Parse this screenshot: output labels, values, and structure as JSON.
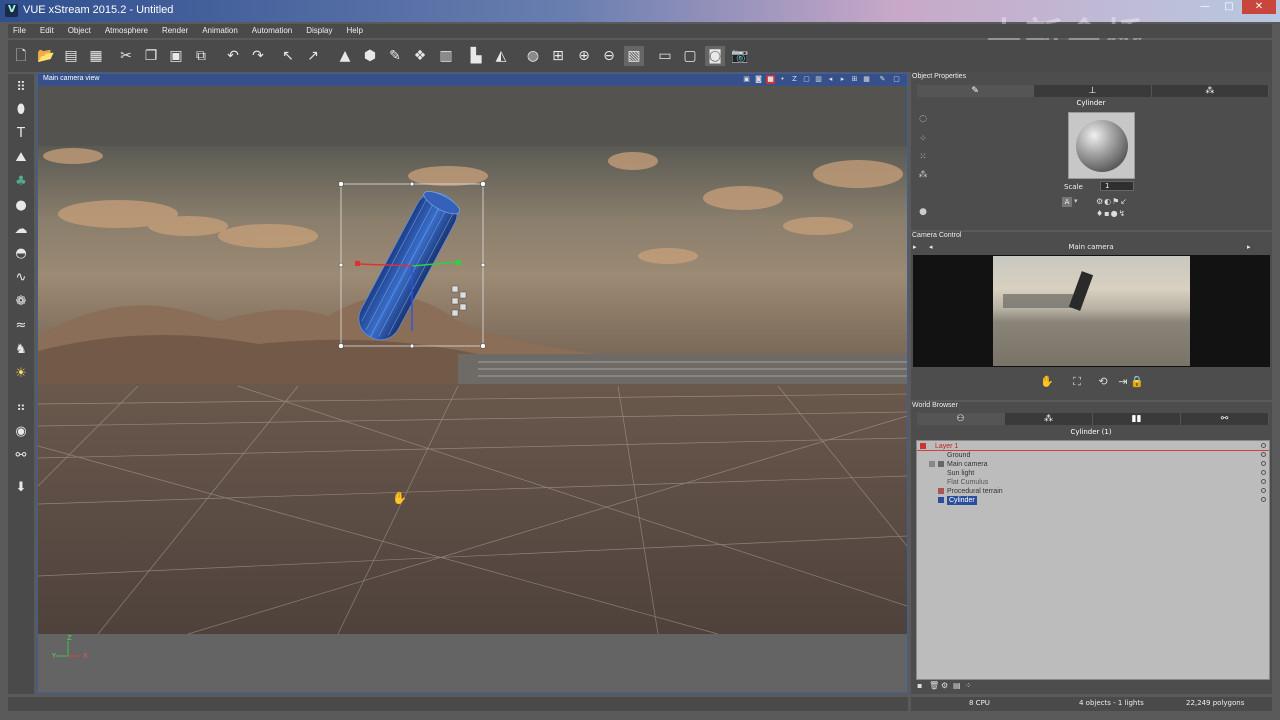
{
  "window": {
    "title": "VUE xStream 2015.2 - Untitled",
    "min": "—",
    "max": "□",
    "close": "✕",
    "watermark": "中新金桥"
  },
  "menu": [
    "File",
    "Edit",
    "Object",
    "Atmosphere",
    "Render",
    "Animation",
    "Automation",
    "Display",
    "Help"
  ],
  "toolbar_icons": [
    "new-file-icon",
    "open-folder-icon",
    "save-icon",
    "save-as-icon",
    "cut-icon",
    "copy-icon",
    "paste-icon",
    "duplicate-icon",
    "undo-icon",
    "redo-icon",
    "select-icon",
    "move-icon",
    "terrain-icon",
    "rock-icon",
    "brush-icon",
    "material-icon",
    "film-icon",
    "align-icon",
    "mirror-icon",
    "globe-icon",
    "grid-icon",
    "zoom-in-icon",
    "zoom-out-icon",
    "region-render-icon",
    "render-icon",
    "frame-icon",
    "camera-icon",
    "snapshot-icon"
  ],
  "viewport": {
    "title": "Main camera view",
    "axis_z": "Z",
    "axis_y": "Y",
    "axis_x": "X"
  },
  "object_properties": {
    "panel_title": "Object Properties",
    "object_name": "Cylinder",
    "scale_label": "Scale",
    "scale_value": "1",
    "material_tag": "A"
  },
  "camera_control": {
    "panel_title": "Camera Control",
    "camera_name": "Main camera"
  },
  "world_browser": {
    "panel_title": "World Browser",
    "selection": "Cylinder (1)",
    "items": [
      {
        "label": "Layer 1",
        "kind": "layer"
      },
      {
        "label": "Ground",
        "kind": "item"
      },
      {
        "label": "Main camera",
        "kind": "item"
      },
      {
        "label": "Sun light",
        "kind": "item"
      },
      {
        "label": "Flat Cumulus",
        "kind": "item"
      },
      {
        "label": "Procedural terrain",
        "kind": "item"
      },
      {
        "label": "Cylinder",
        "kind": "selected"
      }
    ]
  },
  "status": {
    "cpu": "8 CPU",
    "objects": "4 objects - 1 lights",
    "polygons": "22,249 polygons"
  },
  "colors": {
    "panel_bg": "#4d4d4d",
    "viewport_border": "#3d5f9c",
    "selection_blue": "#2b4d9c",
    "cylinder_blue": "#2e5fb8"
  }
}
